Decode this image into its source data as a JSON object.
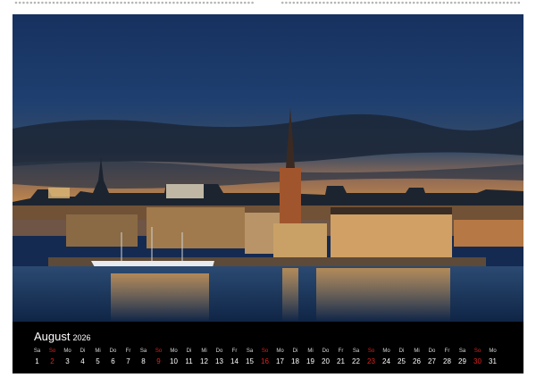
{
  "calendar": {
    "month": "August",
    "year": "2026",
    "days": [
      {
        "wd": "Sa",
        "n": "1"
      },
      {
        "wd": "So",
        "n": "2"
      },
      {
        "wd": "Mo",
        "n": "3"
      },
      {
        "wd": "Di",
        "n": "4"
      },
      {
        "wd": "Mi",
        "n": "5"
      },
      {
        "wd": "Do",
        "n": "6"
      },
      {
        "wd": "Fr",
        "n": "7"
      },
      {
        "wd": "Sa",
        "n": "8"
      },
      {
        "wd": "So",
        "n": "9"
      },
      {
        "wd": "Mo",
        "n": "10"
      },
      {
        "wd": "Di",
        "n": "11"
      },
      {
        "wd": "Mi",
        "n": "12"
      },
      {
        "wd": "Do",
        "n": "13"
      },
      {
        "wd": "Fr",
        "n": "14"
      },
      {
        "wd": "Sa",
        "n": "15"
      },
      {
        "wd": "So",
        "n": "16"
      },
      {
        "wd": "Mo",
        "n": "17"
      },
      {
        "wd": "Di",
        "n": "18"
      },
      {
        "wd": "Mi",
        "n": "19"
      },
      {
        "wd": "Do",
        "n": "20"
      },
      {
        "wd": "Fr",
        "n": "21"
      },
      {
        "wd": "Sa",
        "n": "22"
      },
      {
        "wd": "So",
        "n": "23"
      },
      {
        "wd": "Mo",
        "n": "24"
      },
      {
        "wd": "Di",
        "n": "25"
      },
      {
        "wd": "Mi",
        "n": "26"
      },
      {
        "wd": "Do",
        "n": "27"
      },
      {
        "wd": "Fr",
        "n": "28"
      },
      {
        "wd": "Sa",
        "n": "29"
      },
      {
        "wd": "So",
        "n": "30"
      },
      {
        "wd": "Mo",
        "n": "31"
      }
    ]
  },
  "colors": {
    "sunday": "#e0231f",
    "strip_background": "#000000",
    "sky_top": "#1a3a6b",
    "water": "#16335a"
  }
}
